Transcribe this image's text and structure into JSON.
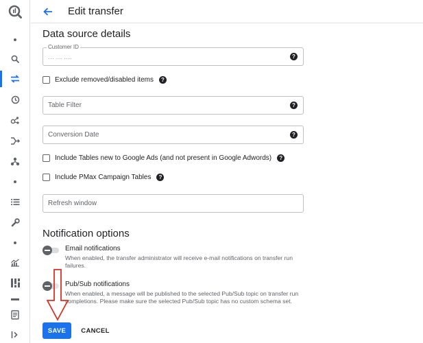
{
  "header": {
    "title": "Edit transfer"
  },
  "data_source": {
    "title": "Data source details",
    "customer_id": {
      "label": "Customer ID",
      "value": "··· ··· ····"
    },
    "exclude_removed": {
      "label": "Exclude removed/disabled items",
      "checked": false
    },
    "table_filter": {
      "placeholder": "Table Filter"
    },
    "conversion_date": {
      "placeholder": "Conversion Date"
    },
    "include_new_tables": {
      "label": "Include Tables new to Google Ads (and not present in Google Adwords)",
      "checked": false
    },
    "include_pmax": {
      "label": "Include PMax Campaign Tables",
      "checked": false
    },
    "refresh_window": {
      "placeholder": "Refresh window"
    }
  },
  "notification": {
    "title": "Notification options",
    "email": {
      "label": "Email notifications",
      "description": "When enabled, the transfer administrator will receive e-mail notifications on transfer run failures.",
      "enabled": false
    },
    "pubsub": {
      "label": "Pub/Sub notifications",
      "description": "When enabled, a message will be published to the selected Pub/Sub topic on transfer run completions. Please make sure the selected Pub/Sub topic has no custom schema set.",
      "enabled": false
    }
  },
  "actions": {
    "save_label": "SAVE",
    "cancel_label": "CANCEL"
  },
  "colors": {
    "accent": "#1a73e8",
    "annotation": "#d93025"
  },
  "icons": {
    "rail": [
      "bigquery-logo-icon",
      "search-icon",
      "transfers-icon",
      "history-icon",
      "analytics-hub-icon",
      "dataflow-icon",
      "dataform-icon",
      "list-icon",
      "wrench-icon",
      "monitoring-icon",
      "dashboard-icon",
      "release-notes-icon",
      "collapse-icon"
    ],
    "help": "help-icon",
    "back": "arrow-back-icon"
  }
}
